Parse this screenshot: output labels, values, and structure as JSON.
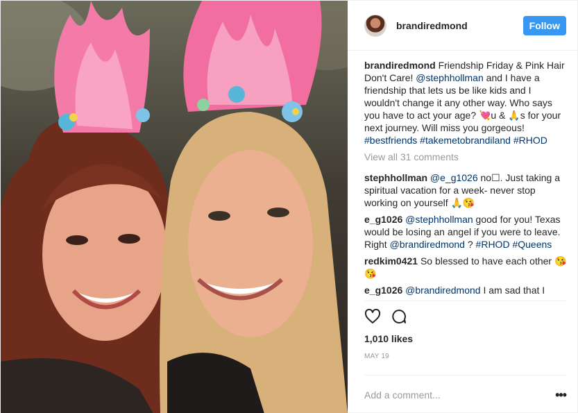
{
  "header": {
    "username": "brandiredmond",
    "follow_label": "Follow"
  },
  "caption": {
    "username": "brandiredmond",
    "text_1": "Friendship Friday & Pink Hair Don't Care! ",
    "mention": "@stephhollman",
    "text_2": " and I have a friendship that lets us be like kids and I wouldn't change it any other way. Who says you have to act your age? 💘u & 🙏s for your next journey. Will miss you gorgeous! ",
    "hashtag_1": "#bestfriends",
    "hashtag_2": "#takemetobrandiland",
    "hashtag_3": "#RHOD"
  },
  "view_all": "View all 31 comments",
  "comments": [
    {
      "user": "stephhollman",
      "mention": "@e_g1026",
      "text": " no☐. Just taking a spiritual vacation for a week- never stop working on yourself 🙏😘"
    },
    {
      "user": "e_g1026",
      "mention": "@stephhollman",
      "text": " good for you! Texas would be losing an angel if you were to leave. Right ",
      "mention2": "@brandiredmond",
      "text2": " ? ",
      "tag1": "#RHOD",
      "tag2": "#Queens"
    },
    {
      "user": "redkim0421",
      "text": " So blessed to have each other 😘😘"
    },
    {
      "user": "e_g1026",
      "mention": "@brandiredmond",
      "text": " I am sad that I"
    }
  ],
  "icons": {
    "like": "heart-icon",
    "comment": "comment-bubble-icon",
    "more": "more-options-icon"
  },
  "likes": "1,010 likes",
  "date": "MAY 19",
  "add_comment": {
    "placeholder": "Add a comment..."
  },
  "more_label": "•••",
  "colors": {
    "follow": "#3897f0",
    "link": "#003569",
    "muted": "#999999",
    "border": "#efefef"
  }
}
